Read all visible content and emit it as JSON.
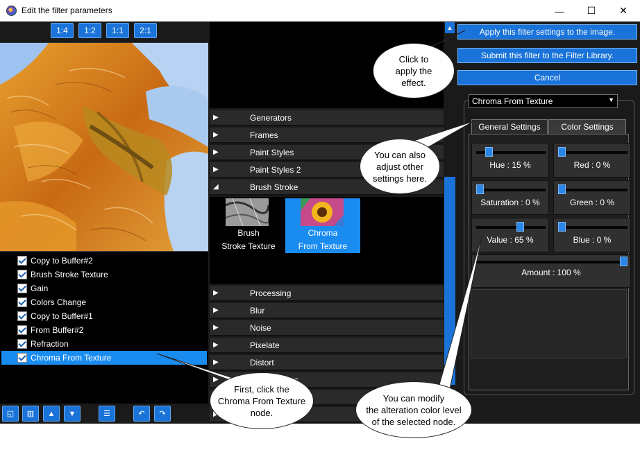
{
  "window": {
    "title": "Edit the filter parameters",
    "minimize": "—",
    "maximize": "☐",
    "close": "✕"
  },
  "zoom": [
    "1:4",
    "1:2",
    "1:1",
    "2:1"
  ],
  "nodes": [
    "Copy to Buffer#2",
    "Brush Stroke Texture",
    "Gain",
    "Colors Change",
    "Copy to Buffer#1",
    "From Buffer#2",
    "Refraction",
    "Chroma From Texture"
  ],
  "categories_top": [
    "Generators",
    "Frames",
    "Paint Styles",
    "Paint Styles 2",
    "Brush Stroke"
  ],
  "categories_bottom": [
    "Processing",
    "Blur",
    "Noise",
    "Pixelate",
    "Distort"
  ],
  "hidden_category_fragment": "rs",
  "gallery": [
    {
      "line1": "Brush",
      "line2": "Stroke Texture"
    },
    {
      "line1": "Chroma",
      "line2": "From Texture"
    }
  ],
  "actions": {
    "apply": "Apply this filter settings to the image.",
    "submit": "Submit this filter to the Filter Library.",
    "cancel": "Cancel"
  },
  "filter_select": {
    "value": "Chroma From Texture"
  },
  "tabs": {
    "general": "General Settings",
    "color": "Color Settings"
  },
  "sliders": [
    {
      "label": "Hue : 15 %",
      "value": 15
    },
    {
      "label": "Red : 0 %",
      "value": 0
    },
    {
      "label": "Saturation : 0 %",
      "value": 0
    },
    {
      "label": "Green : 0 %",
      "value": 0
    },
    {
      "label": "Value : 65 %",
      "value": 65
    },
    {
      "label": "Blue : 0 %",
      "value": 0
    },
    {
      "label": "Amount : 100 %",
      "value": 100
    }
  ],
  "callouts": {
    "apply": [
      "Click to",
      "apply the",
      "effect."
    ],
    "adjust": [
      "You can also",
      "adjust other",
      "settings here."
    ],
    "node": [
      "First, click the",
      "Chroma From Texture",
      "node."
    ],
    "modify": [
      "You can modify",
      "the alteration color level",
      "of the selected node."
    ]
  },
  "colors": {
    "accent": "#1a73d9",
    "selected": "#1a8cf0",
    "panel": "#1a1a1a"
  }
}
